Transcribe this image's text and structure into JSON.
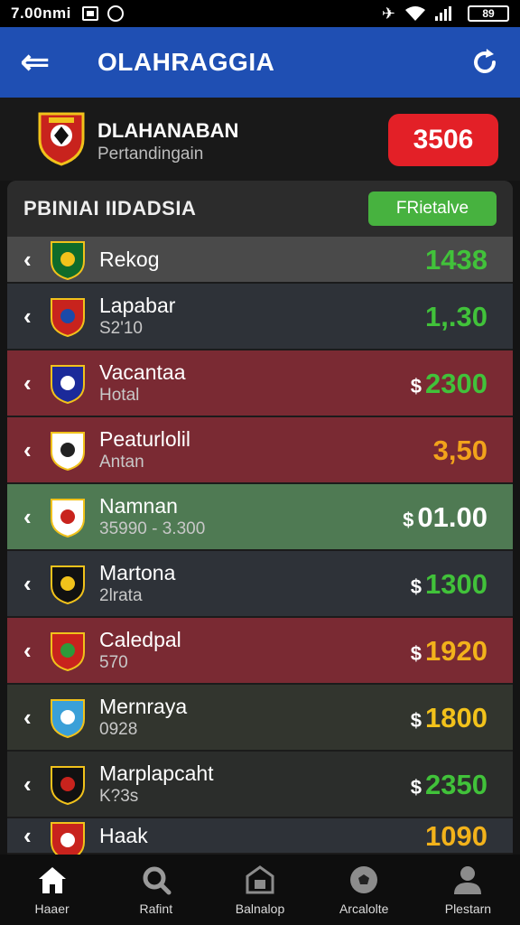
{
  "status": {
    "time": "7.00nmi",
    "battery": "89"
  },
  "appbar": {
    "title": "OLAHRAGGIA"
  },
  "hero": {
    "title": "DLAHANABAN",
    "subtitle": "Pertandingain",
    "score": "3506"
  },
  "panel": {
    "title": "PBINIAI IIDADSIA",
    "filter_label": "FRietalve"
  },
  "rows": [
    {
      "name": "Rekog",
      "sub": "",
      "value": "1438",
      "currency": "",
      "value_color": "#41c23a",
      "bg": "r-gray"
    },
    {
      "name": "Lapabar",
      "sub": "S2'10",
      "value": "1,.30",
      "currency": "",
      "value_color": "#41c23a",
      "bg": "r-dark"
    },
    {
      "name": "Vacantaa",
      "sub": "Hotal",
      "value": "2300",
      "currency": "$",
      "value_color": "#41c23a",
      "bg": "r-red"
    },
    {
      "name": "Peaturlolil",
      "sub": "Antan",
      "value": "3,50",
      "currency": "",
      "value_color": "#f2a31b",
      "bg": "r-red"
    },
    {
      "name": "Namnan",
      "sub": "35990 - 3.300",
      "value": "01.00",
      "currency": "$",
      "value_color": "#ffffff",
      "bg": "r-green"
    },
    {
      "name": "Martona",
      "sub": "2lrata",
      "value": "1300",
      "currency": "$",
      "value_color": "#41c23a",
      "bg": "r-dark"
    },
    {
      "name": "Caledpal",
      "sub": "570",
      "value": "1920",
      "currency": "$",
      "value_color": "#f2b21b",
      "bg": "r-red"
    },
    {
      "name": "Mernraya",
      "sub": "0928",
      "value": "1800",
      "currency": "$",
      "value_color": "#f2c21b",
      "bg": "r-olive"
    },
    {
      "name": "Marplapcaht",
      "sub": "K?3s",
      "value": "2350",
      "currency": "$",
      "value_color": "#41c23a",
      "bg": "r-darker"
    },
    {
      "name": "Haak",
      "sub": "",
      "value": "1090",
      "currency": "",
      "value_color": "#f2b21b",
      "bg": "r-dark"
    }
  ],
  "nav": [
    {
      "label": "Haaer",
      "icon": "home-icon"
    },
    {
      "label": "Rafint",
      "icon": "search-icon"
    },
    {
      "label": "Balnalop",
      "icon": "stadium-icon"
    },
    {
      "label": "Arcalolte",
      "icon": "ball-icon"
    },
    {
      "label": "Plestarn",
      "icon": "profile-icon"
    }
  ],
  "colors": {
    "appbar": "#1f4fb3",
    "score_badge": "#e32027",
    "filter_button": "#47b23f"
  }
}
